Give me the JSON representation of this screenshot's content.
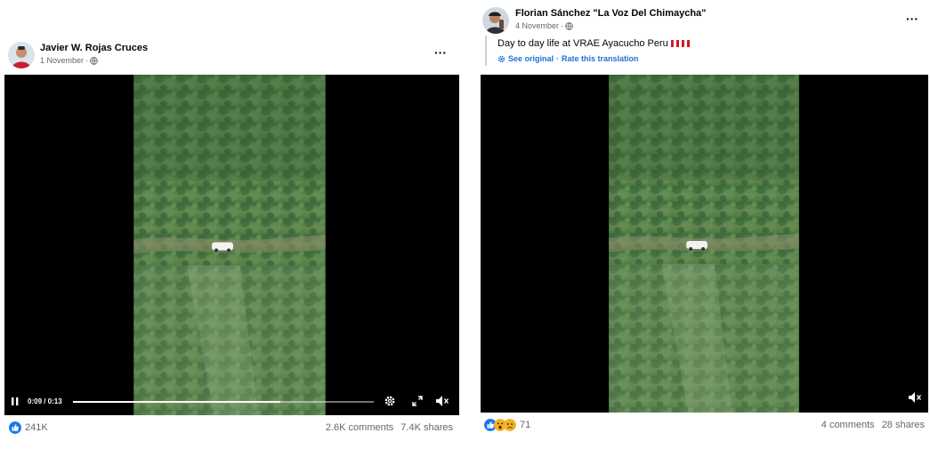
{
  "posts": [
    {
      "author": "Javier W. Rojas Cruces",
      "date": "1 November",
      "date_sep": "·",
      "video": {
        "playing": true,
        "time_display": "0:09 / 0:13",
        "progress": 0.69
      },
      "reactions": {
        "count": "241K",
        "icons": [
          "like-icon"
        ]
      },
      "comments": "2.6K comments",
      "shares": "7.4K shares"
    },
    {
      "author": "Florian Sánchez \"La Voz Del Chimaycha\"",
      "date": "4 November",
      "date_sep": "·",
      "caption": "Day to day life at VRAE Ayacucho Peru",
      "caption_flag": "peru-flag-icon",
      "translation": {
        "see_original": "See original",
        "separator": "·",
        "rate": "Rate this translation"
      },
      "reactions": {
        "count": "71",
        "icons": [
          "like-icon",
          "wow-icon",
          "sad-icon"
        ]
      },
      "comments": "4 comments",
      "shares": "28 shares"
    }
  ],
  "colors": {
    "link": "#216fdb",
    "secondary_text": "#65676b",
    "like_blue": "#1877f2",
    "reaction_yellow": "#f7b125"
  }
}
